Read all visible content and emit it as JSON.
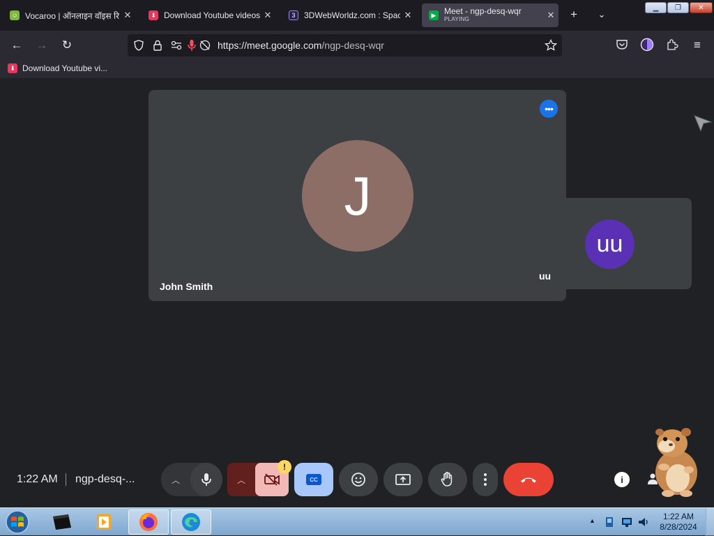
{
  "browser": {
    "tabs": [
      {
        "title": "Vocaroo | ऑनलाइन वॉइस रि",
        "icon": "vocaroo-icon",
        "active": false
      },
      {
        "title": "Download Youtube videos",
        "icon": "download-icon",
        "active": false
      },
      {
        "title": "3DWebWorldz.com : Space",
        "icon": "3dweb-icon",
        "active": false
      },
      {
        "title": "Meet - ngp-desq-wqr",
        "subtitle": "PLAYING",
        "icon": "google-meet-icon",
        "active": true
      }
    ],
    "url_host": "https://meet.google.com",
    "url_path": "/ngp-desq-wqr",
    "bookmark": "Download Youtube vi..."
  },
  "meet": {
    "main_tile": {
      "initial": "J",
      "name": "John Smith",
      "avatar_color": "#8c6e67"
    },
    "self_tile": {
      "initial": "uu",
      "name": "uu",
      "avatar_color": "#5a30b5"
    },
    "time": "1:22 AM",
    "meeting_code": "ngp-desq-...",
    "camera_warning": "!",
    "cc_label": "CC",
    "accent_leave": "#ea4335"
  },
  "taskbar": {
    "clock_time": "1:22 AM",
    "clock_date": "8/28/2024"
  }
}
